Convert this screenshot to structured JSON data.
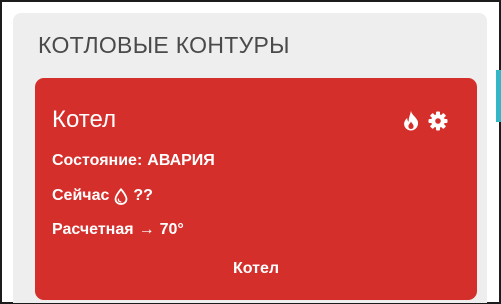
{
  "section": {
    "title": "КОТЛОВЫЕ КОНТУРЫ"
  },
  "card": {
    "title": "Котел",
    "color": "#d52f2b",
    "status_label": "Состояние:",
    "status_value": "АВАРИЯ",
    "now_label": "Сейчас",
    "now_value": "??",
    "calc_label": "Расчетная",
    "calc_arrow": "→",
    "calc_value": "70°",
    "footer_button": "Котел",
    "icons": [
      "flame-icon",
      "gear-icon",
      "water-drop-icon"
    ]
  }
}
